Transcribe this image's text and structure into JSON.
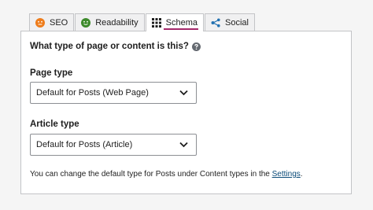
{
  "tabs": [
    {
      "label": "SEO",
      "icon": "face-neutral-icon",
      "icon_color": "#ee7c1b"
    },
    {
      "label": "Readability",
      "icon": "face-smile-icon",
      "icon_color": "#7ad03a"
    },
    {
      "label": "Schema",
      "icon": "grid-icon",
      "active": true
    },
    {
      "label": "Social",
      "icon": "share-icon",
      "icon_color": "#2271b1"
    }
  ],
  "question": "What type of page or content is this?",
  "page_type": {
    "label": "Page type",
    "value": "Default for Posts (Web Page)"
  },
  "article_type": {
    "label": "Article type",
    "value": "Default for Posts (Article)"
  },
  "note": {
    "text": "You can change the default type for Posts under Content types in the",
    "link": "Settings",
    "end": "."
  },
  "colors": {
    "accent": "#a4286a",
    "link": "#0a4b78"
  }
}
